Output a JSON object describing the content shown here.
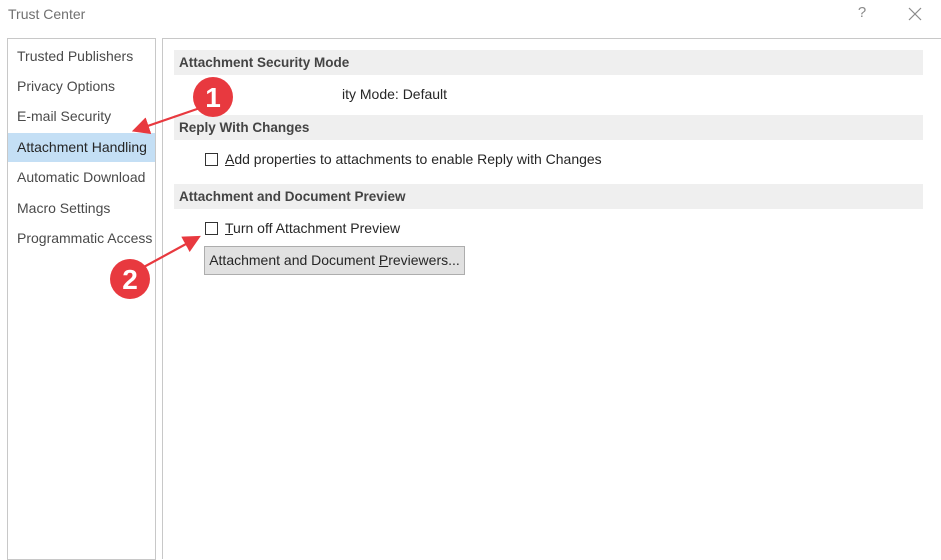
{
  "window": {
    "title": "Trust Center",
    "help_label": "?"
  },
  "sidebar": {
    "items": [
      {
        "label": "Trusted Publishers",
        "active": false
      },
      {
        "label": "Privacy Options",
        "active": false
      },
      {
        "label": "E-mail Security",
        "active": false
      },
      {
        "label": "Attachment Handling",
        "active": true
      },
      {
        "label": "Automatic Download",
        "active": false
      },
      {
        "label": "Macro Settings",
        "active": false
      },
      {
        "label": "Programmatic Access",
        "active": false
      }
    ]
  },
  "sections": {
    "security_mode": {
      "header": "Attachment Security Mode",
      "visible_text": "ity Mode: Default"
    },
    "reply_changes": {
      "header": "Reply With Changes",
      "checkbox": {
        "mnemonic": "A",
        "rest": "dd properties to attachments to enable Reply with Changes",
        "checked": false
      }
    },
    "preview": {
      "header": "Attachment and Document Preview",
      "checkbox": {
        "mnemonic": "T",
        "rest": "urn off Attachment Preview",
        "checked": false
      },
      "button": {
        "before": "Attachment and Document ",
        "mnemonic": "P",
        "after": "reviewers..."
      }
    }
  },
  "annotations": [
    {
      "number": "1",
      "color": "#e8393f"
    },
    {
      "number": "2",
      "color": "#e8393f"
    }
  ]
}
